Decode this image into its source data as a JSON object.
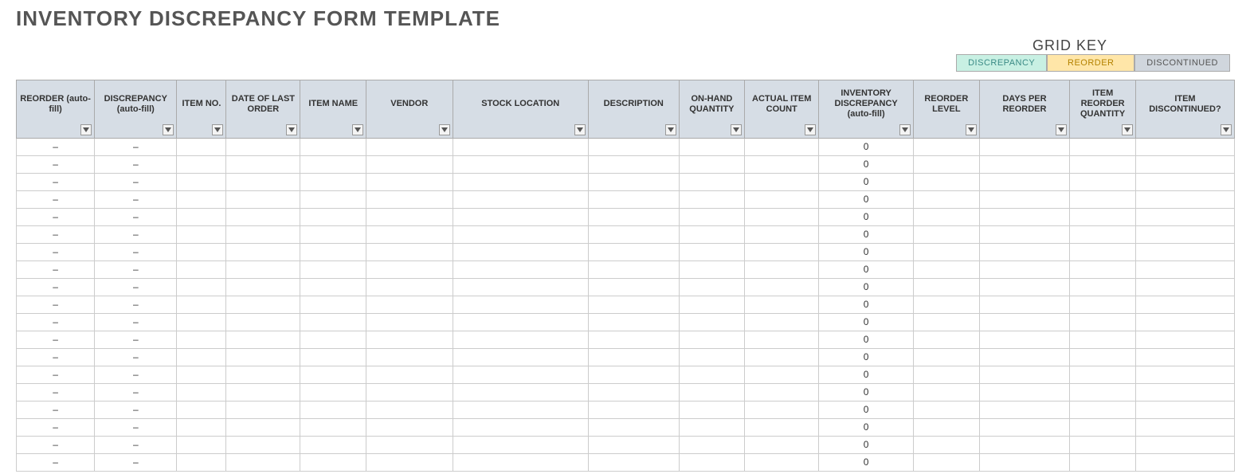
{
  "title": "INVENTORY DISCREPANCY FORM TEMPLATE",
  "gridkey": {
    "heading": "GRID KEY",
    "discrepancy": "DISCREPANCY",
    "reorder": "REORDER",
    "discontinued": "DISCONTINUED"
  },
  "columns": [
    {
      "label": "REORDER (auto-fill)"
    },
    {
      "label": "DISCREPANCY (auto-fill)"
    },
    {
      "label": "ITEM NO."
    },
    {
      "label": "DATE OF LAST ORDER"
    },
    {
      "label": "ITEM NAME"
    },
    {
      "label": "VENDOR"
    },
    {
      "label": "STOCK LOCATION"
    },
    {
      "label": "DESCRIPTION"
    },
    {
      "label": "ON-HAND QUANTITY"
    },
    {
      "label": "ACTUAL ITEM COUNT"
    },
    {
      "label": "INVENTORY DISCREPANCY (auto-fill)"
    },
    {
      "label": "REORDER LEVEL"
    },
    {
      "label": "DAYS PER REORDER"
    },
    {
      "label": "ITEM REORDER QUANTITY"
    },
    {
      "label": "ITEM DISCONTINUED?"
    }
  ],
  "rows": [
    {
      "reorder": "–",
      "discrepancy": "–",
      "inv_disc": "0"
    },
    {
      "reorder": "–",
      "discrepancy": "–",
      "inv_disc": "0"
    },
    {
      "reorder": "–",
      "discrepancy": "–",
      "inv_disc": "0"
    },
    {
      "reorder": "–",
      "discrepancy": "–",
      "inv_disc": "0"
    },
    {
      "reorder": "–",
      "discrepancy": "–",
      "inv_disc": "0"
    },
    {
      "reorder": "–",
      "discrepancy": "–",
      "inv_disc": "0"
    },
    {
      "reorder": "–",
      "discrepancy": "–",
      "inv_disc": "0"
    },
    {
      "reorder": "–",
      "discrepancy": "–",
      "inv_disc": "0"
    },
    {
      "reorder": "–",
      "discrepancy": "–",
      "inv_disc": "0"
    },
    {
      "reorder": "–",
      "discrepancy": "–",
      "inv_disc": "0"
    },
    {
      "reorder": "–",
      "discrepancy": "–",
      "inv_disc": "0"
    },
    {
      "reorder": "–",
      "discrepancy": "–",
      "inv_disc": "0"
    },
    {
      "reorder": "–",
      "discrepancy": "–",
      "inv_disc": "0"
    },
    {
      "reorder": "–",
      "discrepancy": "–",
      "inv_disc": "0"
    },
    {
      "reorder": "–",
      "discrepancy": "–",
      "inv_disc": "0"
    },
    {
      "reorder": "–",
      "discrepancy": "–",
      "inv_disc": "0"
    },
    {
      "reorder": "–",
      "discrepancy": "–",
      "inv_disc": "0"
    },
    {
      "reorder": "–",
      "discrepancy": "–",
      "inv_disc": "0"
    },
    {
      "reorder": "–",
      "discrepancy": "–",
      "inv_disc": "0"
    }
  ]
}
